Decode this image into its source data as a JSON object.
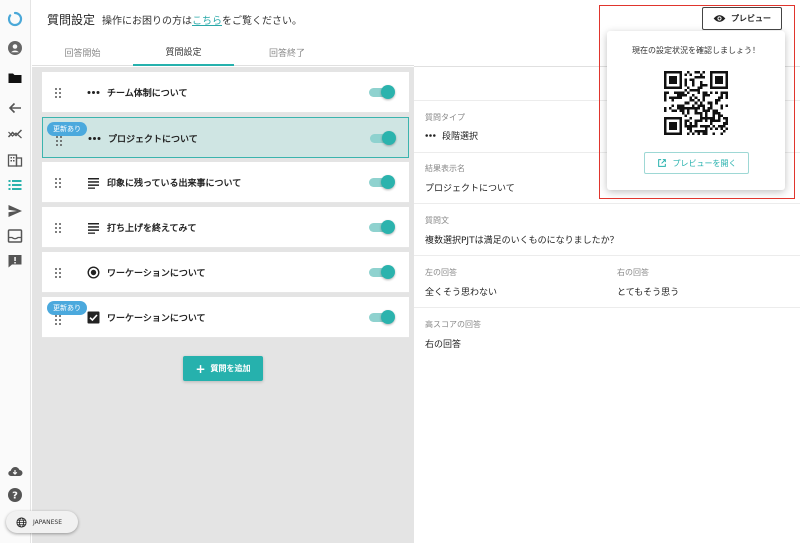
{
  "header": {
    "title": "質問設定",
    "help_prefix": "操作にお困りの方は",
    "help_link": "こちら",
    "help_suffix": "をご覧ください。"
  },
  "tabs": [
    {
      "label": "回答開始"
    },
    {
      "label": "質問設定"
    },
    {
      "label": "回答終了"
    }
  ],
  "active_tab": "質問設定",
  "questions": [
    {
      "label": "チーム体制について",
      "icon": "dots-icon",
      "enabled": true,
      "badge": ""
    },
    {
      "label": "プロジェクトについて",
      "icon": "dots-icon",
      "enabled": true,
      "badge": "更新あり"
    },
    {
      "label": "印象に残っている出来事について",
      "icon": "lines-icon",
      "enabled": true,
      "badge": ""
    },
    {
      "label": "打ち上げを終えてみて",
      "icon": "lines-icon",
      "enabled": true,
      "badge": ""
    },
    {
      "label": "ワーケーションについて",
      "icon": "radio-icon",
      "enabled": true,
      "badge": ""
    },
    {
      "label": "ワーケーションについて",
      "icon": "checkbox-icon",
      "enabled": true,
      "badge": "更新あり"
    }
  ],
  "add_button": "質問を追加",
  "detail": {
    "type_label": "質問タイプ",
    "type_value": "段階選択",
    "result_label": "結果表示名",
    "result_value": "プロジェクトについて",
    "question_label": "質問文",
    "question_value": "複数選択PJTは満足のいくものになりましたか？",
    "left_label": "左の回答",
    "left_value": "全くそう思わない",
    "right_label": "右の回答",
    "right_value": "とてもそう思う",
    "high_label": "高スコアの回答",
    "high_value": "右の回答"
  },
  "preview": {
    "button": "プレビュー",
    "message": "現在の設定状況を確認しましょう！",
    "open_button": "プレビューを開く"
  },
  "language": "JAPANESE",
  "colors": {
    "accent": "#26b1ad",
    "badge": "#4ba9dd",
    "selected_row": "#cfe5e3",
    "highlight_box": "#e0352d"
  }
}
